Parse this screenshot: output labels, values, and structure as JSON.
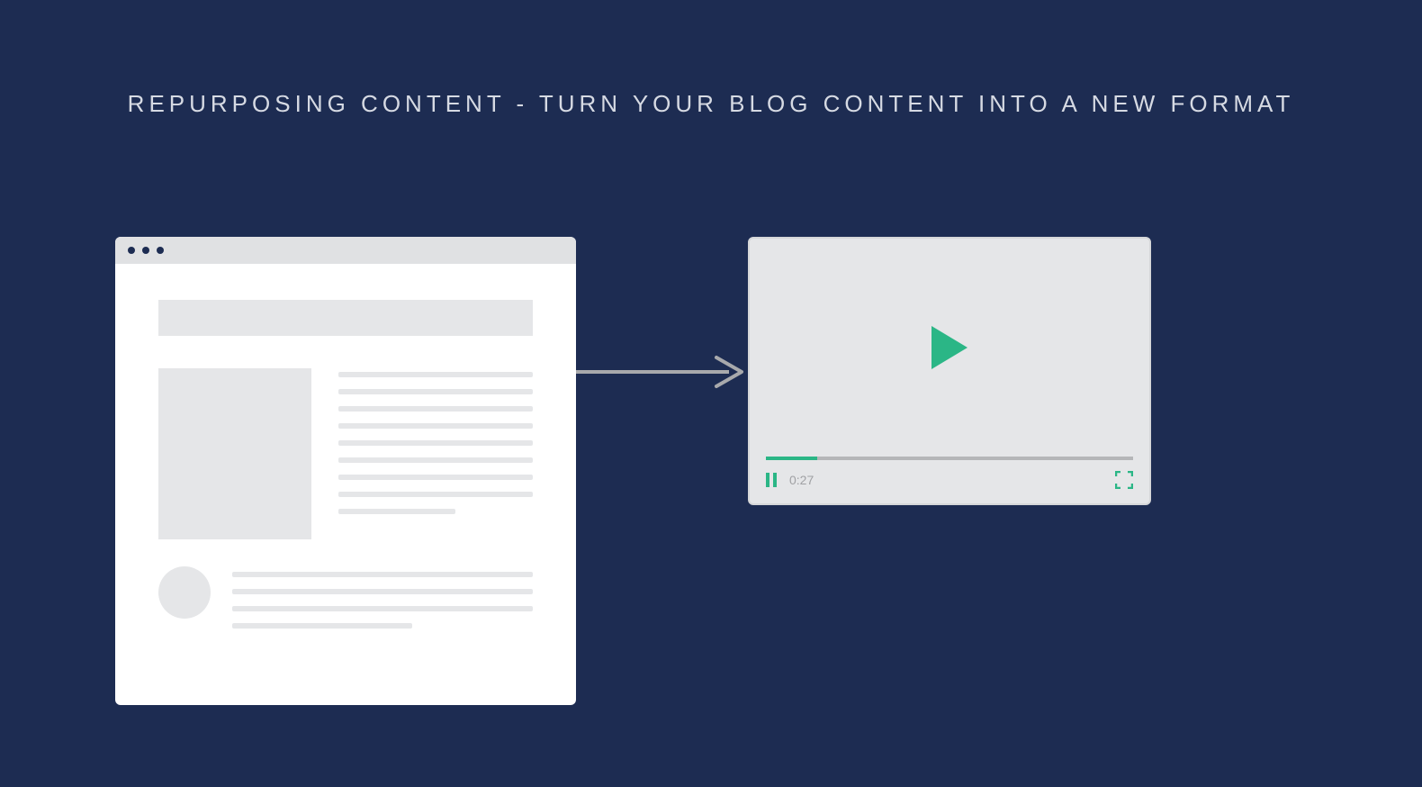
{
  "title": "REPURPOSING CONTENT - TURN YOUR BLOG CONTENT INTO A NEW FORMAT",
  "video": {
    "time": "0:27",
    "progress_percent": 14
  },
  "colors": {
    "background": "#1d2c52",
    "accent": "#2bb686",
    "placeholder": "#e5e6e8"
  }
}
